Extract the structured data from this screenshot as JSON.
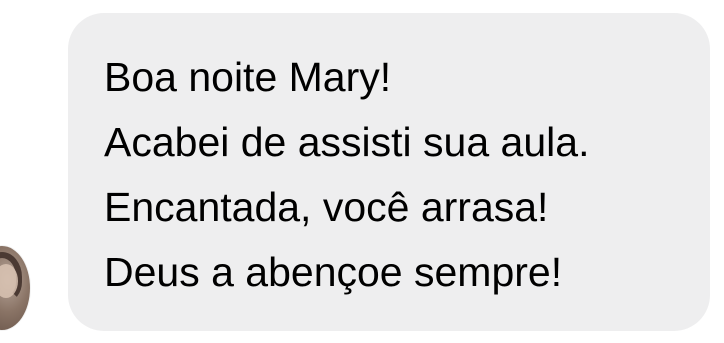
{
  "message": {
    "lines": [
      "Boa noite Mary!",
      "Acabei de assisti sua aula.",
      "Encantada, você arrasa!",
      "Deus a abençoe sempre!"
    ]
  },
  "colors": {
    "bubble_background": "#eeeeef",
    "text": "#000000",
    "page_background": "#ffffff"
  },
  "icons": {
    "avatar": "sender-avatar-photo"
  }
}
